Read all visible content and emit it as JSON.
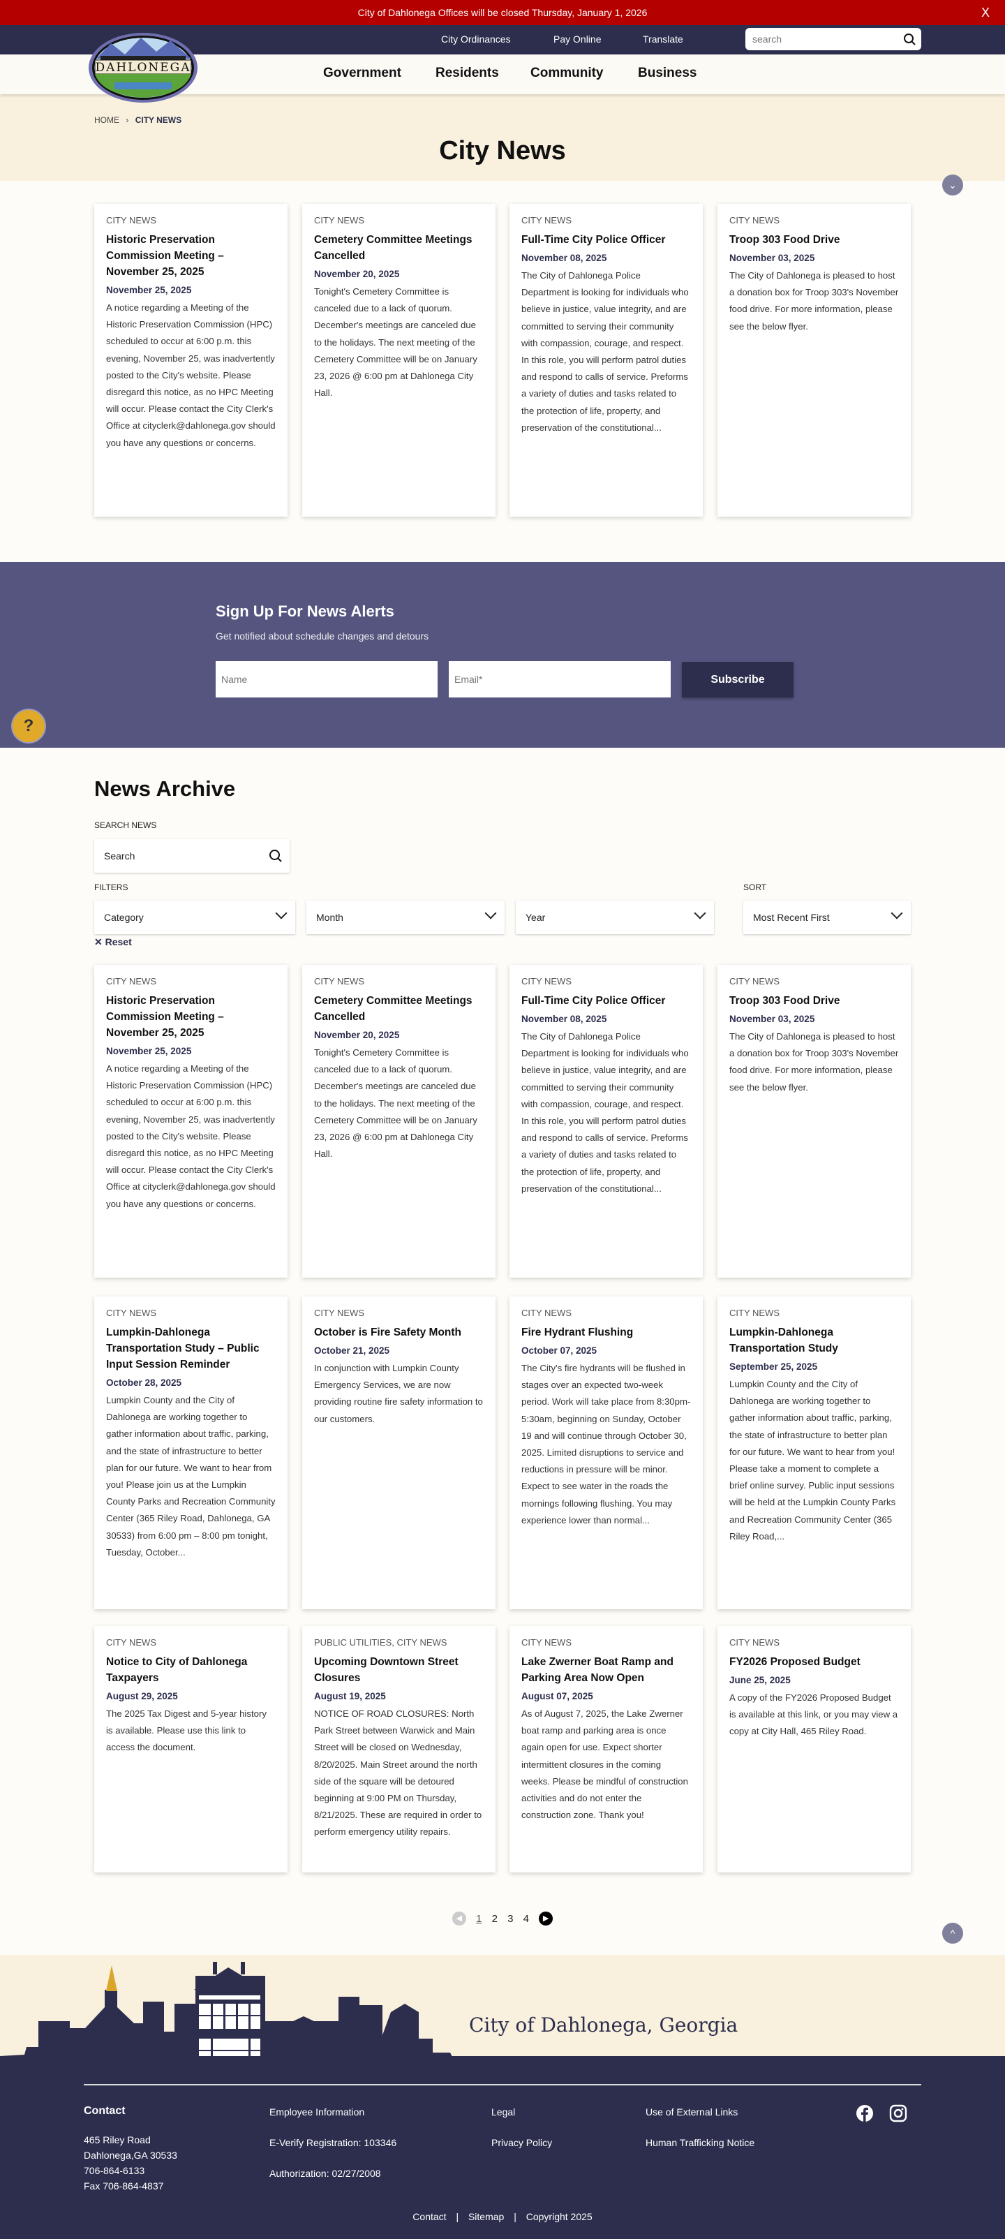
{
  "alert": {
    "text": "City of Dahlonega Offices will be closed Thursday, January 1, 2026",
    "close": "X"
  },
  "top_links": [
    "City Ordinances",
    "Pay Online",
    "Translate"
  ],
  "top_search": {
    "placeholder": "search"
  },
  "logo": {
    "text": "DAHLONEGA"
  },
  "main_nav": [
    "Government",
    "Residents",
    "Community",
    "Business"
  ],
  "breadcrumb": {
    "home": "HOME",
    "current": "CITY NEWS"
  },
  "page_title": "City News",
  "featured": [
    {
      "cat": "CITY NEWS",
      "title": "Historic Preservation Commission Meeting – November 25, 2025",
      "date": "November 25, 2025",
      "body": "A notice regarding a Meeting of the Historic Preservation Commission (HPC) scheduled to occur at 6:00 p.m. this evening, November 25, was inadvertently posted to the City's website.  Please disregard this notice, as no HPC Meeting will occur. Please contact the City Clerk's Office at cityclerk@dahlonega.gov should you have any questions or concerns."
    },
    {
      "cat": "CITY NEWS",
      "title": "Cemetery Committee Meetings Cancelled",
      "date": "November 20, 2025",
      "body": "Tonight's Cemetery Committee is canceled due to a lack of quorum. December's meetings are canceled due to the holidays. The next meeting of the Cemetery Committee will be on January 23, 2026 @ 6:00 pm at Dahlonega City Hall."
    },
    {
      "cat": "CITY NEWS",
      "title": "Full-Time City Police Officer",
      "date": "November 08, 2025",
      "body": "The City of Dahlonega Police Department is looking for individuals who believe in justice, value integrity, and are committed to serving their community with compassion, courage, and respect. In this role, you will perform patrol duties and respond to calls of service. Preforms a variety of duties and tasks related to the protection of life, property, and preservation of the constitutional..."
    },
    {
      "cat": "CITY NEWS",
      "title": "Troop 303 Food Drive",
      "date": "November 03, 2025",
      "body": "The City of Dahlonega is pleased to host a donation box for Troop 303's November food drive. For more information, please see the below flyer."
    }
  ],
  "signup": {
    "title": "Sign Up For News Alerts",
    "subtitle": "Get notified about schedule changes and detours",
    "name_placeholder": "Name",
    "email_placeholder": "Email*",
    "button": "Subscribe"
  },
  "help": "?",
  "archive": {
    "title": "News Archive",
    "search_label": "SEARCH NEWS",
    "search_placeholder": "Search",
    "filters_label": "FILTERS",
    "sort_label": "SORT",
    "category": "Category",
    "month": "Month",
    "year": "Year",
    "sort": "Most Recent First",
    "reset": "✕ Reset",
    "rows": [
      [
        {
          "cat": "CITY NEWS",
          "title": "Historic Preservation Commission Meeting – November 25, 2025",
          "date": "November 25, 2025",
          "body": "A notice regarding a Meeting of the Historic Preservation Commission (HPC) scheduled to occur at 6:00 p.m. this evening, November 25, was inadvertently posted to the City's website.  Please disregard this notice, as no HPC Meeting will occur. Please contact the City Clerk's Office at cityclerk@dahlonega.gov should you have any questions or concerns."
        },
        {
          "cat": "CITY NEWS",
          "title": "Cemetery Committee Meetings Cancelled",
          "date": "November 20, 2025",
          "body": "Tonight's Cemetery Committee is canceled due to a lack of quorum. December's meetings are canceled due to the holidays. The next meeting of the Cemetery Committee will be on January 23, 2026 @ 6:00 pm at Dahlonega City Hall."
        },
        {
          "cat": "CITY NEWS",
          "title": "Full-Time City Police Officer",
          "date": "November 08, 2025",
          "body": "The City of Dahlonega Police Department is looking for individuals who believe in justice, value integrity, and are committed to serving their community with compassion, courage, and respect. In this role, you will perform patrol duties and respond to calls of service. Preforms a variety of duties and tasks related to the protection of life, property, and preservation of the constitutional..."
        },
        {
          "cat": "CITY NEWS",
          "title": "Troop 303 Food Drive",
          "date": "November 03, 2025",
          "body": "The City of Dahlonega is pleased to host a donation box for Troop 303's November food drive. For more information, please see the below flyer."
        }
      ],
      [
        {
          "cat": "CITY NEWS",
          "title": "Lumpkin-Dahlonega Transportation Study – Public Input Session Reminder",
          "date": "October 28, 2025",
          "body": "Lumpkin County and the City of Dahlonega are working together to gather information about traffic, parking, and the state of infrastructure to better plan for our future. We want to hear from you! Please join us at the Lumpkin County Parks and Recreation Community Center (365 Riley Road, Dahlonega, GA 30533) from 6:00 pm – 8:00 pm tonight, Tuesday, October..."
        },
        {
          "cat": "CITY NEWS",
          "title": "October is Fire Safety Month",
          "date": "October 21, 2025",
          "body": "In conjunction with Lumpkin County Emergency Services, we are now providing routine fire safety information to our customers."
        },
        {
          "cat": "CITY NEWS",
          "title": "Fire Hydrant Flushing",
          "date": "October 07, 2025",
          "body": "The City's fire hydrants will be flushed in stages over an expected two-week period. Work will take place from 8:30pm-5:30am, beginning on Sunday, October 19 and will continue through October 30, 2025. Limited disruptions to service and reductions in pressure will be minor. Expect to see water in the roads the mornings following flushing. You may experience lower than normal..."
        },
        {
          "cat": "CITY NEWS",
          "title": "Lumpkin-Dahlonega Transportation Study",
          "date": "September 25, 2025",
          "body": "Lumpkin County and the City of Dahlonega are working together to gather information about traffic, parking, the state of infrastructure to better plan for our future. We want to hear from you! Please take a moment to complete a brief online survey. Public input sessions will be held at the Lumpkin County Parks and Recreation Community Center (365 Riley Road,..."
        }
      ],
      [
        {
          "cat": "CITY NEWS",
          "title": "Notice to City of Dahlonega Taxpayers",
          "date": "August 29, 2025",
          "body": "The 2025 Tax Digest and 5-year history is available. Please use this link to access the document."
        },
        {
          "cat": "PUBLIC UTILITIES, CITY NEWS",
          "title": "Upcoming Downtown Street Closures",
          "date": "August 19, 2025",
          "body": "NOTICE OF ROAD CLOSURES: North Park Street between Warwick and Main Street will be closed on Wednesday, 8/20/2025. Main Street around the north side of the square will be detoured beginning at 9:00 PM on Thursday, 8/21/2025. These are required in order to perform emergency utility repairs."
        },
        {
          "cat": "CITY NEWS",
          "title": "Lake Zwerner Boat Ramp and Parking Area Now Open",
          "date": "August 07, 2025",
          "body": "As of August 7, 2025, the Lake Zwerner boat ramp and parking area is once again open for use. Expect shorter intermittent closures in the coming weeks.  Please be mindful of construction activities and do not enter the construction zone. Thank you!"
        },
        {
          "cat": "CITY NEWS",
          "title": "FY2026 Proposed Budget",
          "date": "June 25, 2025",
          "body": "A copy of the FY2026 Proposed Budget is available at this link, or you may view a copy at City Hall, 465 Riley Road."
        }
      ]
    ]
  },
  "pagination": {
    "pages": [
      "1",
      "2",
      "3",
      "4"
    ],
    "current": "1"
  },
  "footer": {
    "city": "City of Dahlonega, Georgia",
    "contact_title": "Contact",
    "contact": [
      "465 Riley Road",
      "Dahlonega,GA 30533",
      "706-864-6133",
      "Fax 706-864-4837"
    ],
    "col2": [
      "Employee Information",
      "E-Verify Registration: 103346",
      "Authorization: 02/27/2008"
    ],
    "col3": [
      "Legal",
      "Privacy Policy"
    ],
    "col4": [
      "Use of External Links",
      "Human Trafficking Notice"
    ],
    "bottom": [
      "Contact",
      "Sitemap",
      "Copyright 2025"
    ]
  },
  "colors": {
    "alert": "#b50000",
    "navy": "#2d2e4e",
    "signup": "#555580",
    "beige": "#f9f1dd",
    "help": "#e0a92a"
  }
}
